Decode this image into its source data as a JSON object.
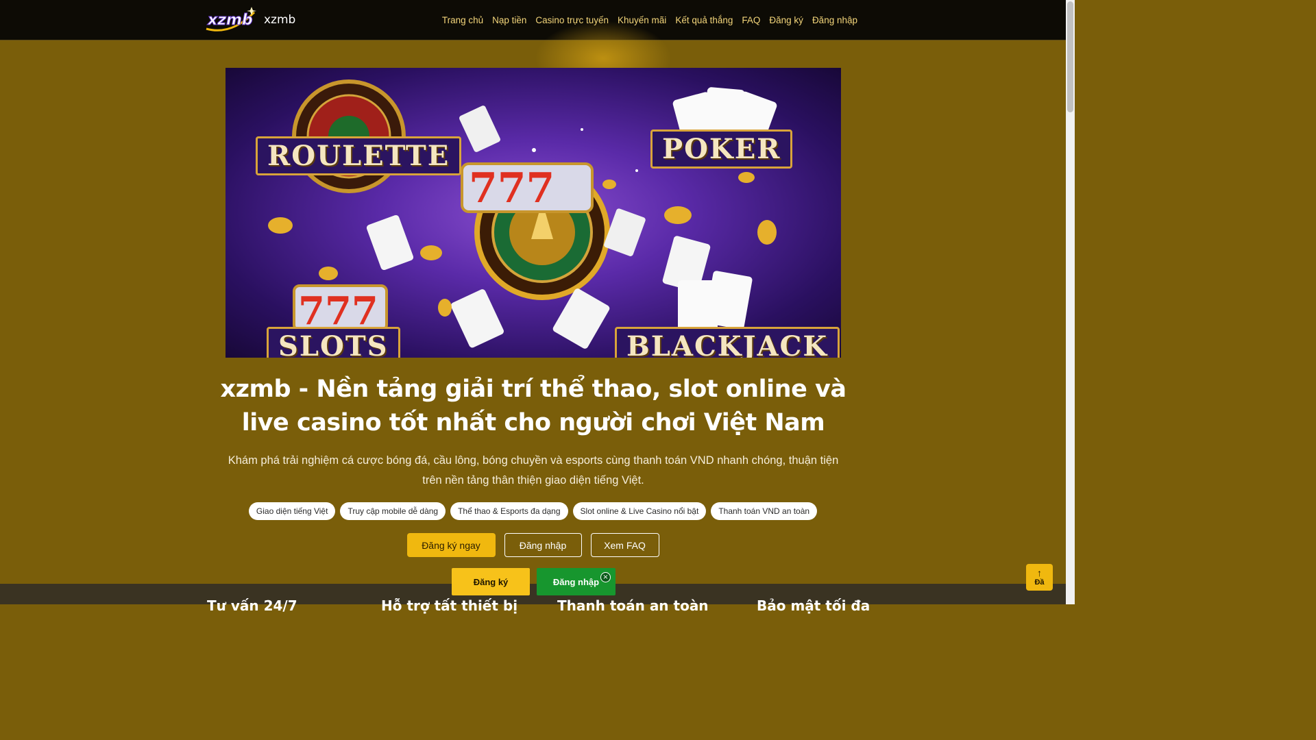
{
  "brand": {
    "name": "xzmb",
    "logo_text": "xzmb"
  },
  "nav": {
    "items": [
      "Trang chủ",
      "Nạp tiền",
      "Casino trực tuyến",
      "Khuyến mãi",
      "Kết quả thắng",
      "FAQ",
      "Đăng ký",
      "Đăng nhập"
    ]
  },
  "hero": {
    "labels": {
      "roulette": "ROULETTE",
      "poker": "POKER",
      "slots": "SLOTS",
      "blackjack": "BLACKJACK"
    }
  },
  "headline": {
    "line1": "xzmb - Nền tảng giải trí thể thao, slot online và",
    "line2": "live casino tốt nhất cho người chơi Việt Nam"
  },
  "subtext": {
    "line1": "Khám phá trải nghiệm cá cược bóng đá, cầu lông, bóng chuyền và esports cùng thanh toán VND nhanh chóng, thuận tiện",
    "line2": "trên nền tảng thân thiện giao diện tiếng Việt."
  },
  "chips": [
    "Giao diện tiếng Việt",
    "Truy cập mobile dễ dàng",
    "Thể thao & Esports đa dạng",
    "Slot online & Live Casino nổi bật",
    "Thanh toán VND an toàn"
  ],
  "cta": {
    "register": "Đăng ký ngay",
    "login": "Đăng nhập",
    "faq": "Xem FAQ"
  },
  "strip": {
    "col1": "Tư vấn 24/7",
    "col2": "Hỗ trợ tất thiết bị",
    "col3": "Thanh toán an toàn",
    "col4": "Bảo mật tối đa"
  },
  "sticky": {
    "register": "Đăng ký",
    "login": "Đăng nhập",
    "close": "×"
  },
  "back_to_top": {
    "arrow": "↑",
    "label": "Đầ"
  },
  "colors": {
    "page_bg": "#7a5e0a",
    "header_bg": "#0d0b05",
    "accent_gold": "#f0b80f",
    "login_green": "#17962e"
  }
}
